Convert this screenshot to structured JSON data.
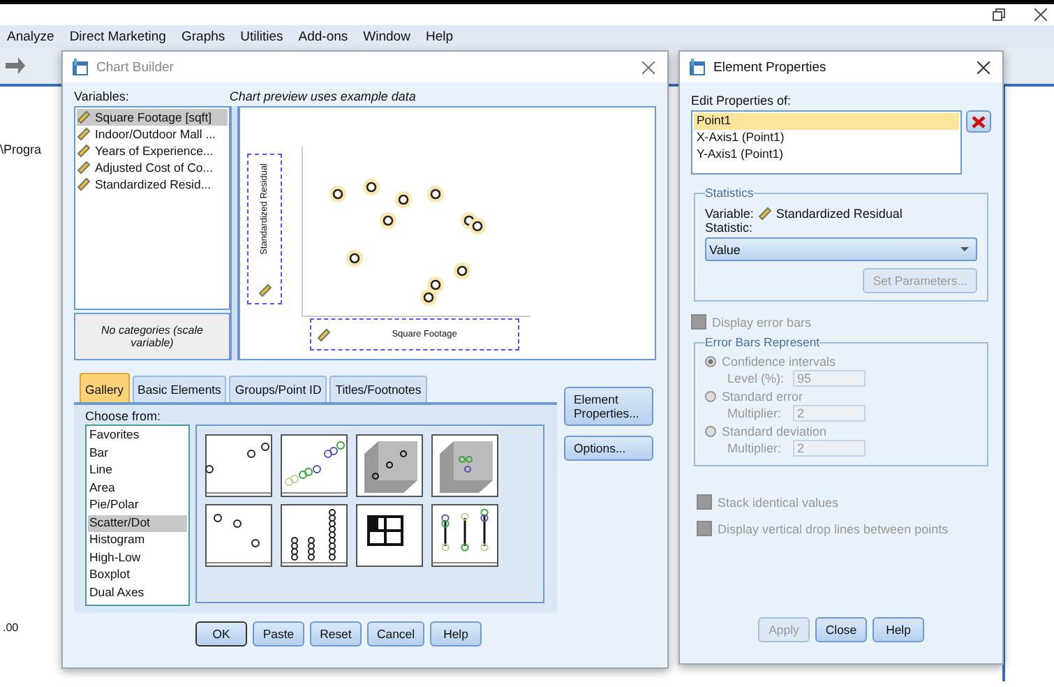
{
  "app": {
    "menu": [
      "Analyze",
      "Direct Marketing",
      "Graphs",
      "Utilities",
      "Add-ons",
      "Window",
      "Help"
    ],
    "path_text": "\\Progra",
    "axis_value": ".00"
  },
  "chart_builder": {
    "title": "Chart Builder",
    "variables_label": "Variables:",
    "variables": [
      {
        "name": "Square Footage [sqft]",
        "selected": true
      },
      {
        "name": "Indoor/Outdoor Mall ...",
        "selected": false
      },
      {
        "name": "Years of Experience...",
        "selected": false
      },
      {
        "name": "Adjusted Cost of Co...",
        "selected": false
      },
      {
        "name": "Standardized Resid...",
        "selected": false
      }
    ],
    "categories_note": "No categories (scale variable)",
    "preview_caption": "Chart preview uses example data",
    "y_axis_label": "Standardized Residual",
    "x_axis_label": "Square Footage",
    "tabs": [
      {
        "label": "Gallery",
        "selected": true
      },
      {
        "label": "Basic Elements",
        "selected": false
      },
      {
        "label": "Groups/Point ID",
        "selected": false
      },
      {
        "label": "Titles/Footnotes",
        "selected": false
      }
    ],
    "choose_from_label": "Choose from:",
    "chart_types": [
      {
        "label": "Favorites",
        "selected": false
      },
      {
        "label": "Bar",
        "selected": false
      },
      {
        "label": "Line",
        "selected": false
      },
      {
        "label": "Area",
        "selected": false
      },
      {
        "label": "Pie/Polar",
        "selected": false
      },
      {
        "label": "Scatter/Dot",
        "selected": true
      },
      {
        "label": "Histogram",
        "selected": false
      },
      {
        "label": "High-Low",
        "selected": false
      },
      {
        "label": "Boxplot",
        "selected": false
      },
      {
        "label": "Dual Axes",
        "selected": false
      }
    ],
    "side_buttons": [
      "Element Properties...",
      "Options..."
    ],
    "buttons": [
      "OK",
      "Paste",
      "Reset",
      "Cancel",
      "Help"
    ]
  },
  "element_properties": {
    "title": "Element Properties",
    "edit_label": "Edit Properties of:",
    "items": [
      {
        "label": "Point1",
        "selected": true
      },
      {
        "label": "X-Axis1 (Point1)",
        "selected": false
      },
      {
        "label": "Y-Axis1 (Point1)",
        "selected": false
      }
    ],
    "statistics": {
      "title": "Statistics",
      "variable_label": "Variable:",
      "variable": "Standardized Residual",
      "statistic_label": "Statistic:",
      "statistic": "Value",
      "set_parameters": {
        "label": "Set Parameters...",
        "disabled": true
      }
    },
    "display_error_bars": {
      "label": "Display error bars",
      "checked": false,
      "disabled": true
    },
    "error_bars": {
      "title": "Error Bars Represent",
      "options": [
        {
          "label": "Confidence intervals",
          "selected": true,
          "disabled": true,
          "field_label": "Level (%):",
          "field_value": "95"
        },
        {
          "label": "Standard error",
          "selected": false,
          "disabled": true,
          "field_label": "Multiplier:",
          "field_value": "2"
        },
        {
          "label": "Standard deviation",
          "selected": false,
          "disabled": true,
          "field_label": "Multiplier:",
          "field_value": "2"
        }
      ]
    },
    "checkboxes": [
      {
        "label": "Stack identical values",
        "checked": false,
        "disabled": true
      },
      {
        "label": "Display vertical drop lines between points",
        "checked": false,
        "disabled": true
      }
    ],
    "buttons": [
      {
        "label": "Apply",
        "disabled": true
      },
      {
        "label": "Close",
        "disabled": false
      },
      {
        "label": "Help",
        "disabled": false
      }
    ]
  }
}
